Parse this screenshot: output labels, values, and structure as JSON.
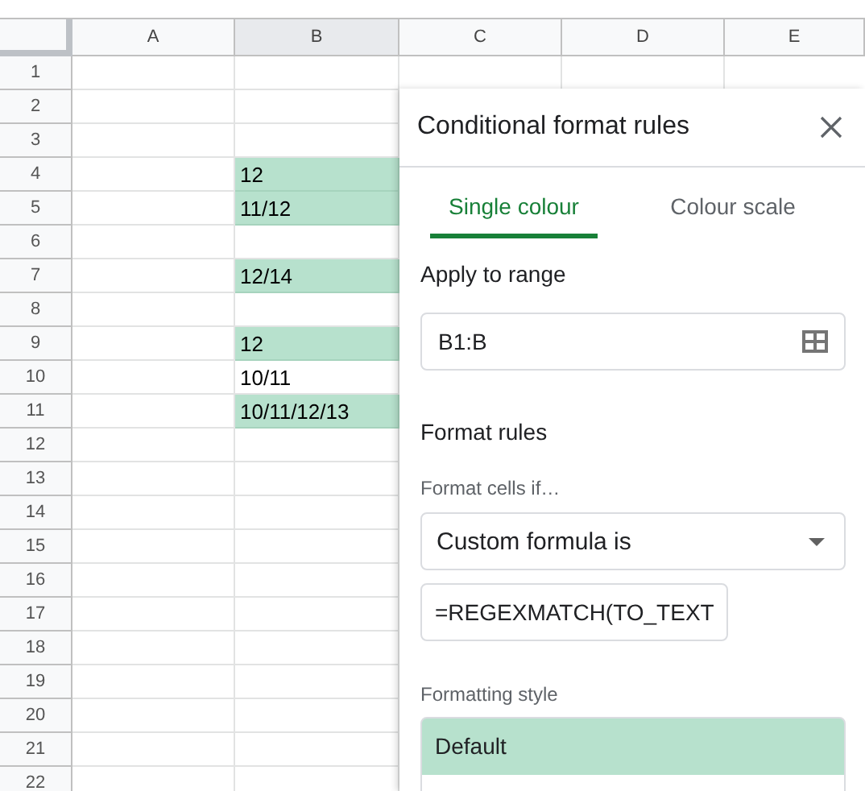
{
  "columns": [
    {
      "label": "A",
      "selected": false
    },
    {
      "label": "B",
      "selected": true
    },
    {
      "label": "C",
      "selected": false
    },
    {
      "label": "D",
      "selected": false
    },
    {
      "label": "E",
      "selected": false
    }
  ],
  "rows": [
    {
      "number": "1"
    },
    {
      "number": "2"
    },
    {
      "number": "3"
    },
    {
      "number": "4",
      "column_b": "12",
      "highlighted": true
    },
    {
      "number": "5",
      "column_b": "11/12",
      "highlighted": true
    },
    {
      "number": "6"
    },
    {
      "number": "7",
      "column_b": "12/14",
      "highlighted": true
    },
    {
      "number": "8"
    },
    {
      "number": "9",
      "column_b": "12",
      "highlighted": true
    },
    {
      "number": "10",
      "column_b": "10/11",
      "highlighted": false
    },
    {
      "number": "11",
      "column_b": "10/11/12/13",
      "highlighted": true
    },
    {
      "number": "12"
    },
    {
      "number": "13"
    },
    {
      "number": "14"
    },
    {
      "number": "15"
    },
    {
      "number": "16"
    },
    {
      "number": "17"
    },
    {
      "number": "18"
    },
    {
      "number": "19"
    },
    {
      "number": "20"
    },
    {
      "number": "21"
    },
    {
      "number": "22"
    }
  ],
  "panel": {
    "title": "Conditional format rules",
    "tabs": [
      {
        "label": "Single colour",
        "selected": true
      },
      {
        "label": "Colour scale",
        "selected": false
      }
    ],
    "range_label": "Apply to range",
    "range_value": "B1:B",
    "section_title": "Format rules",
    "condition_label": "Format cells if…",
    "condition": "Custom formula is",
    "formula": "=REGEXMATCH(TO_TEXT",
    "style_label": "Formatting style",
    "style_preset": "Default"
  }
}
